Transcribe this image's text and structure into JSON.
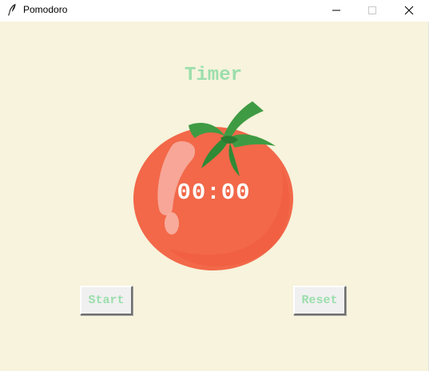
{
  "window": {
    "title": "Pomodoro",
    "app_icon": "feather-icon",
    "controls": {
      "minimize_icon": "minimize-icon",
      "maximize_icon": "maximize-icon",
      "close_icon": "close-icon"
    }
  },
  "app": {
    "heading": "Timer",
    "timer_display": "00:00",
    "image": "tomato-image",
    "start_label": "Start",
    "reset_label": "Reset"
  },
  "colors": {
    "background": "#f7f3dc",
    "label_green": "#9bdeac",
    "tomato_red": "#f26849",
    "timer_text": "#ffffff",
    "button_face": "#f0f0f0"
  }
}
